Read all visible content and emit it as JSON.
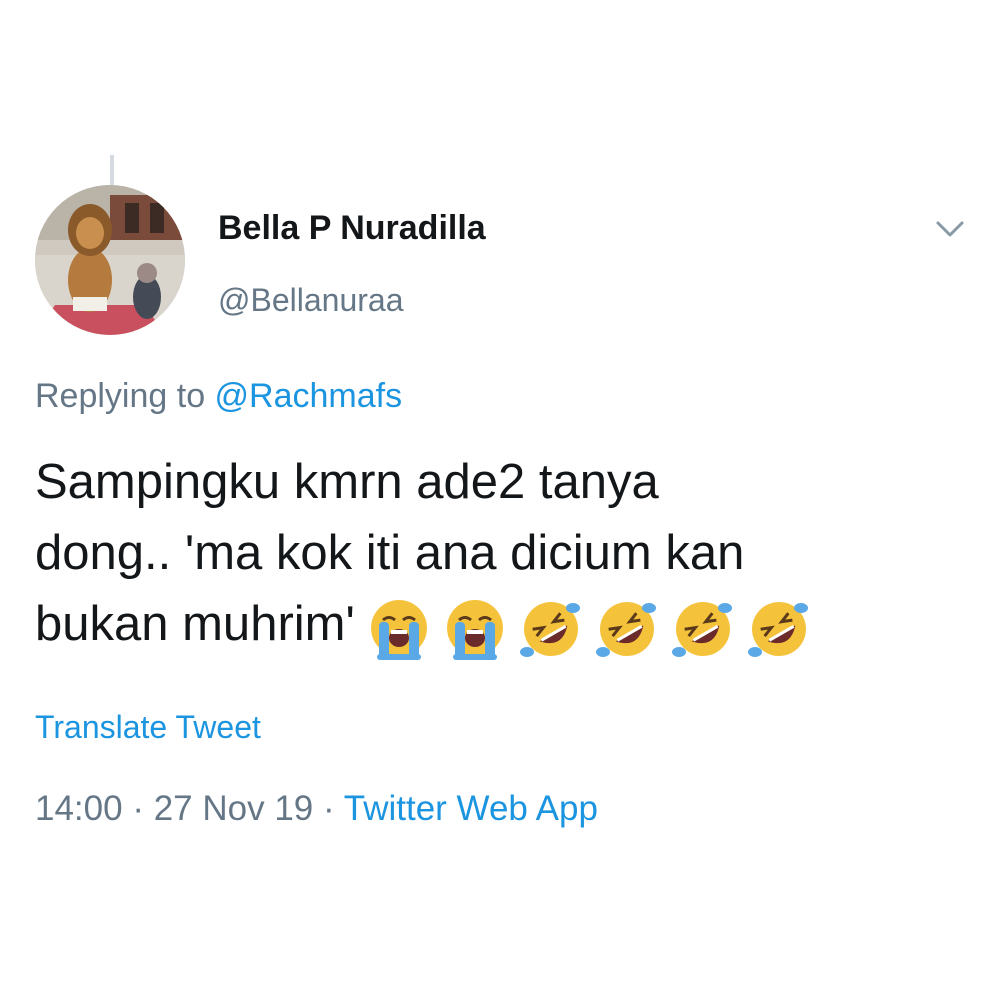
{
  "tweet": {
    "display_name": "Bella P Nuradilla",
    "handle": "@Bellanuraa",
    "replying_prefix": "Replying to ",
    "replying_to": "@Rachmafs",
    "text_line_1": "Sampingku kmrn ade2 tanya",
    "text_line_2": "dong.. 'ma kok iti ana dicium kan",
    "text_line_3": "bukan muhrim'",
    "emojis": [
      "loudly-crying-face",
      "loudly-crying-face",
      "rolling-on-the-floor-laughing",
      "rolling-on-the-floor-laughing",
      "rolling-on-the-floor-laughing",
      "rolling-on-the-floor-laughing"
    ],
    "translate_label": "Translate Tweet",
    "time": "14:00",
    "separator": " · ",
    "date": "27 Nov 19",
    "source": "Twitter Web App"
  },
  "icons": {
    "caret": "chevron-down-icon",
    "avatar": "profile-avatar"
  },
  "colors": {
    "text": "#14171a",
    "secondary": "#657786",
    "link": "#1b95e0",
    "thread_line": "#d5dbe0"
  }
}
